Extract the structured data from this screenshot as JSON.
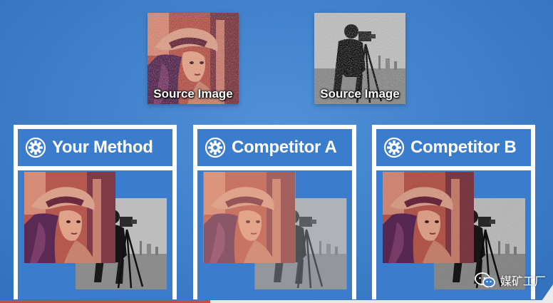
{
  "sources": [
    {
      "id": "lena",
      "label": "Source Image"
    },
    {
      "id": "cameraman",
      "label": "Source Image"
    }
  ],
  "panels": [
    {
      "id": "your",
      "title": "Your Method"
    },
    {
      "id": "a",
      "title": "Competitor A"
    },
    {
      "id": "b",
      "title": "Competitor B"
    }
  ],
  "watermark": {
    "text": "媒矿工厂",
    "icon": "wechat-icon"
  },
  "colors": {
    "background": "#3f7fca",
    "panel": "#ffffff",
    "header": "#3c7ccc"
  }
}
